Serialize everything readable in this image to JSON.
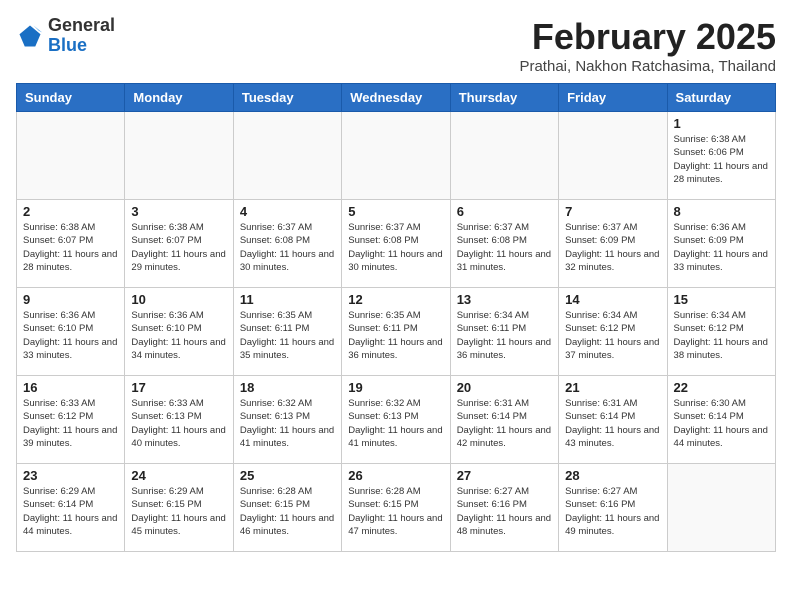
{
  "header": {
    "logo_general": "General",
    "logo_blue": "Blue",
    "month_year": "February 2025",
    "location": "Prathai, Nakhon Ratchasima, Thailand"
  },
  "days_of_week": [
    "Sunday",
    "Monday",
    "Tuesday",
    "Wednesday",
    "Thursday",
    "Friday",
    "Saturday"
  ],
  "weeks": [
    [
      {
        "day": "",
        "info": ""
      },
      {
        "day": "",
        "info": ""
      },
      {
        "day": "",
        "info": ""
      },
      {
        "day": "",
        "info": ""
      },
      {
        "day": "",
        "info": ""
      },
      {
        "day": "",
        "info": ""
      },
      {
        "day": "1",
        "info": "Sunrise: 6:38 AM\nSunset: 6:06 PM\nDaylight: 11 hours and 28 minutes."
      }
    ],
    [
      {
        "day": "2",
        "info": "Sunrise: 6:38 AM\nSunset: 6:07 PM\nDaylight: 11 hours and 28 minutes."
      },
      {
        "day": "3",
        "info": "Sunrise: 6:38 AM\nSunset: 6:07 PM\nDaylight: 11 hours and 29 minutes."
      },
      {
        "day": "4",
        "info": "Sunrise: 6:37 AM\nSunset: 6:08 PM\nDaylight: 11 hours and 30 minutes."
      },
      {
        "day": "5",
        "info": "Sunrise: 6:37 AM\nSunset: 6:08 PM\nDaylight: 11 hours and 30 minutes."
      },
      {
        "day": "6",
        "info": "Sunrise: 6:37 AM\nSunset: 6:08 PM\nDaylight: 11 hours and 31 minutes."
      },
      {
        "day": "7",
        "info": "Sunrise: 6:37 AM\nSunset: 6:09 PM\nDaylight: 11 hours and 32 minutes."
      },
      {
        "day": "8",
        "info": "Sunrise: 6:36 AM\nSunset: 6:09 PM\nDaylight: 11 hours and 33 minutes."
      }
    ],
    [
      {
        "day": "9",
        "info": "Sunrise: 6:36 AM\nSunset: 6:10 PM\nDaylight: 11 hours and 33 minutes."
      },
      {
        "day": "10",
        "info": "Sunrise: 6:36 AM\nSunset: 6:10 PM\nDaylight: 11 hours and 34 minutes."
      },
      {
        "day": "11",
        "info": "Sunrise: 6:35 AM\nSunset: 6:11 PM\nDaylight: 11 hours and 35 minutes."
      },
      {
        "day": "12",
        "info": "Sunrise: 6:35 AM\nSunset: 6:11 PM\nDaylight: 11 hours and 36 minutes."
      },
      {
        "day": "13",
        "info": "Sunrise: 6:34 AM\nSunset: 6:11 PM\nDaylight: 11 hours and 36 minutes."
      },
      {
        "day": "14",
        "info": "Sunrise: 6:34 AM\nSunset: 6:12 PM\nDaylight: 11 hours and 37 minutes."
      },
      {
        "day": "15",
        "info": "Sunrise: 6:34 AM\nSunset: 6:12 PM\nDaylight: 11 hours and 38 minutes."
      }
    ],
    [
      {
        "day": "16",
        "info": "Sunrise: 6:33 AM\nSunset: 6:12 PM\nDaylight: 11 hours and 39 minutes."
      },
      {
        "day": "17",
        "info": "Sunrise: 6:33 AM\nSunset: 6:13 PM\nDaylight: 11 hours and 40 minutes."
      },
      {
        "day": "18",
        "info": "Sunrise: 6:32 AM\nSunset: 6:13 PM\nDaylight: 11 hours and 41 minutes."
      },
      {
        "day": "19",
        "info": "Sunrise: 6:32 AM\nSunset: 6:13 PM\nDaylight: 11 hours and 41 minutes."
      },
      {
        "day": "20",
        "info": "Sunrise: 6:31 AM\nSunset: 6:14 PM\nDaylight: 11 hours and 42 minutes."
      },
      {
        "day": "21",
        "info": "Sunrise: 6:31 AM\nSunset: 6:14 PM\nDaylight: 11 hours and 43 minutes."
      },
      {
        "day": "22",
        "info": "Sunrise: 6:30 AM\nSunset: 6:14 PM\nDaylight: 11 hours and 44 minutes."
      }
    ],
    [
      {
        "day": "23",
        "info": "Sunrise: 6:29 AM\nSunset: 6:14 PM\nDaylight: 11 hours and 44 minutes."
      },
      {
        "day": "24",
        "info": "Sunrise: 6:29 AM\nSunset: 6:15 PM\nDaylight: 11 hours and 45 minutes."
      },
      {
        "day": "25",
        "info": "Sunrise: 6:28 AM\nSunset: 6:15 PM\nDaylight: 11 hours and 46 minutes."
      },
      {
        "day": "26",
        "info": "Sunrise: 6:28 AM\nSunset: 6:15 PM\nDaylight: 11 hours and 47 minutes."
      },
      {
        "day": "27",
        "info": "Sunrise: 6:27 AM\nSunset: 6:16 PM\nDaylight: 11 hours and 48 minutes."
      },
      {
        "day": "28",
        "info": "Sunrise: 6:27 AM\nSunset: 6:16 PM\nDaylight: 11 hours and 49 minutes."
      },
      {
        "day": "",
        "info": ""
      }
    ]
  ]
}
